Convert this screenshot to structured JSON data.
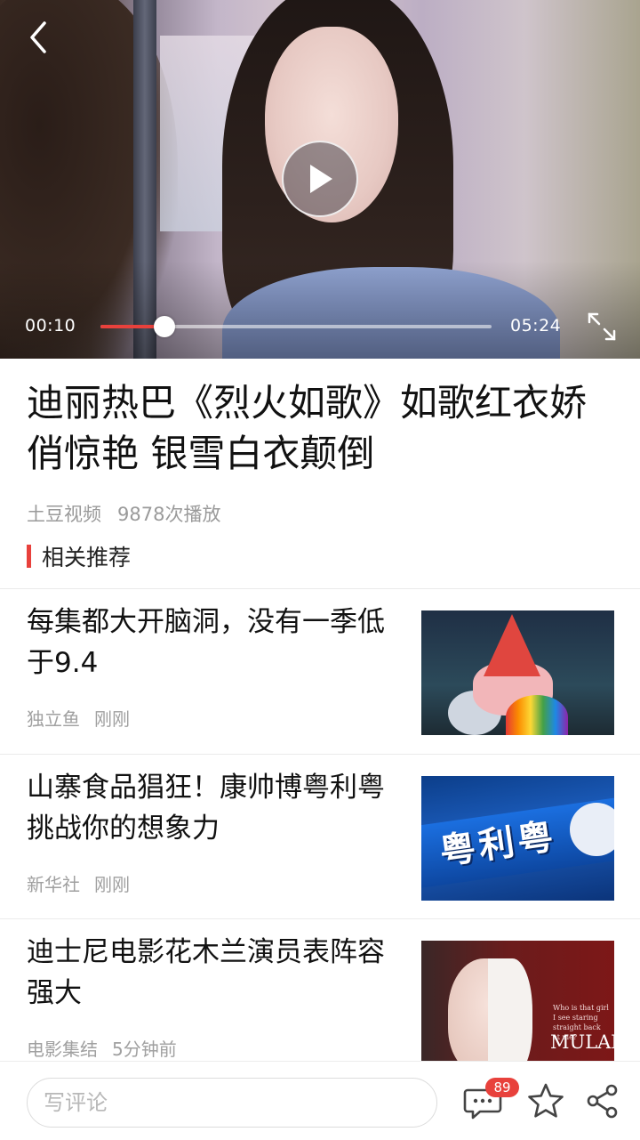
{
  "player": {
    "current_time": "00:10",
    "duration": "05:24",
    "progress_fraction": 0.031,
    "accent_color": "#e8413c"
  },
  "article": {
    "title": "迪丽热巴《烈火如歌》如歌红衣娇俏惊艳 银雪白衣颠倒",
    "source": "土豆视频",
    "play_count": "9878次播放",
    "section_label": "相关推荐"
  },
  "related": [
    {
      "title": "每集都大开脑洞，没有一季低于9.4",
      "source": "独立鱼",
      "time": "刚刚",
      "thumb": "cartoon-thumbnail"
    },
    {
      "title": "山寨食品猖狂！康帅博粤利粤挑战你的想象力",
      "source": "新华社",
      "time": "刚刚",
      "thumb": "cookie-package-thumbnail"
    },
    {
      "title": "迪士尼电影花木兰演员表阵容强大",
      "source": "电影集结",
      "time": "5分钟前",
      "thumb": "movie-poster-thumbnail"
    }
  ],
  "thumb_text": {
    "cookie_brand": "粤利粤",
    "poster_tagline": "Who is that girl I see staring straight back at me?",
    "poster_title": "MULAN"
  },
  "bottom_bar": {
    "comment_placeholder": "写评论",
    "comment_count": "89"
  },
  "icons": [
    "back-icon",
    "play-icon",
    "fullscreen-icon",
    "comment-icon",
    "star-icon",
    "share-icon"
  ]
}
